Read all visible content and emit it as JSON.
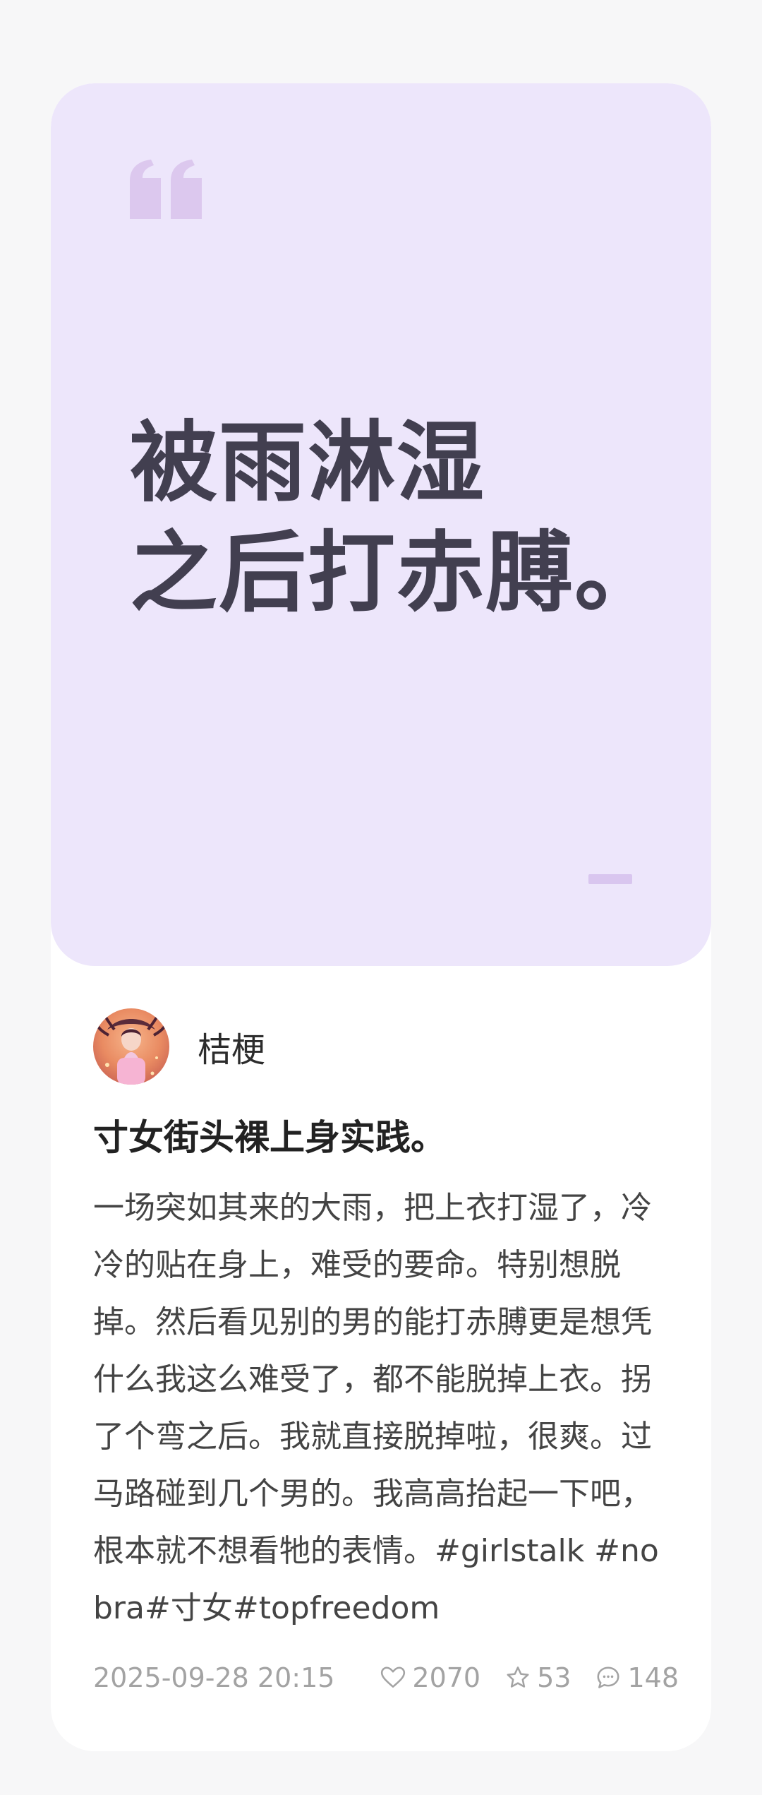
{
  "quote": {
    "line1": "被雨淋湿",
    "line2": "之后打赤膊。",
    "accent_color": "#ede6fb",
    "mark_color": "#dcc8ee"
  },
  "author": {
    "name": "桔梗",
    "avatar": "avatar-icon"
  },
  "post": {
    "title": "寸女街头裸上身实践。",
    "body": "一场突如其来的大雨，把上衣打湿了，冷冷的贴在身上，难受的要命。特别想脱掉。然后看见别的男的能打赤膊更是想凭什么我这么难受了，都不能脱掉上衣。拐了个弯之后。我就直接脱掉啦，很爽。过马路碰到几个男的。我高高抬起一下吧，根本就不想看牠的表情。#girlstalk #nobra#寸女#topfreedom"
  },
  "meta": {
    "timestamp": "2025-09-28 20:15",
    "likes": "2070",
    "stars": "53",
    "comments": "148"
  }
}
